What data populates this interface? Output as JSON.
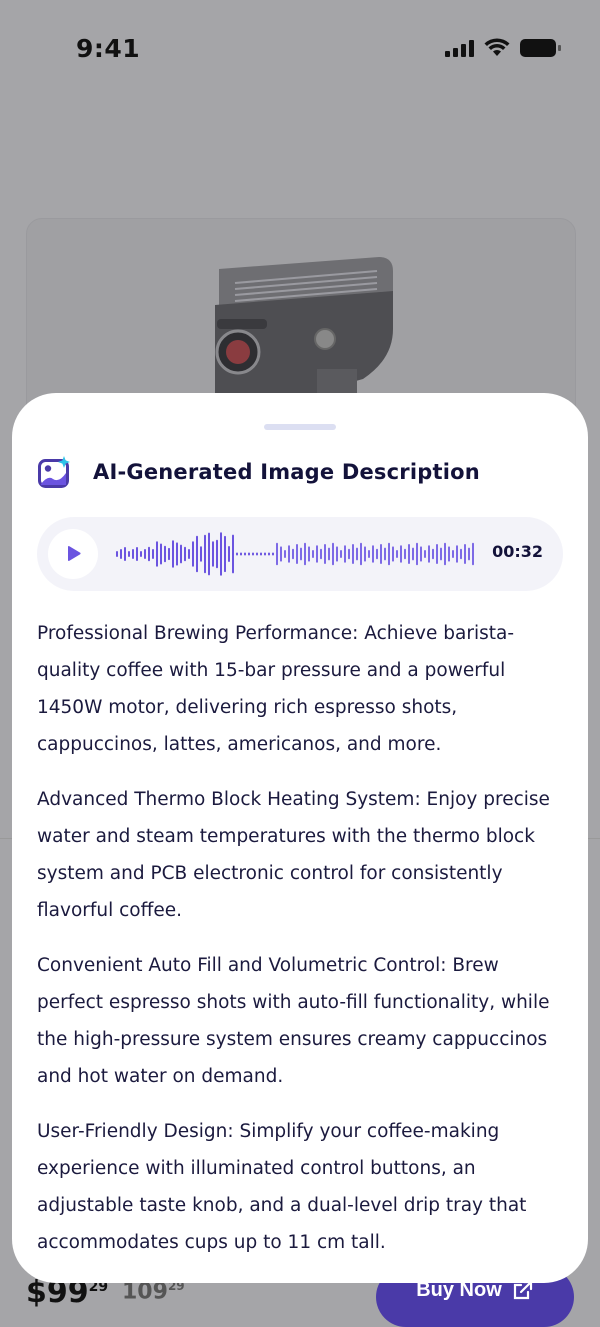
{
  "status": {
    "time": "9:41"
  },
  "bottom": {
    "price_main": "$99",
    "price_cents": "29",
    "price_old_main": "109",
    "price_old_cents": "29",
    "buy_label": "Buy Now"
  },
  "sheet": {
    "title": "AI-Generated Image Description",
    "audio": {
      "duration": "00:32"
    },
    "paragraphs": [
      "Professional Brewing Performance: Achieve barista-quality coffee with 15-bar pressure and a powerful 1450W motor, delivering rich espresso shots, cappuccinos, lattes, americanos, and more.",
      "Advanced Thermo Block Heating System: Enjoy precise water and steam temperatures with the thermo block system and PCB electronic control for consistently flavorful coffee.",
      "Convenient Auto Fill and Volumetric Control: Brew perfect espresso shots with auto-fill functionality, while the high-pressure system ensures creamy cappuccinos and hot water on demand.",
      "User-Friendly Design: Simplify your coffee-making experience with illuminated control buttons, an adjustable taste knob, and a dual-level drip tray that accommodates cups up to 11 cm tall."
    ]
  },
  "colors": {
    "accent": "#6b54e0",
    "ink": "#13123a",
    "sheet_bg": "#ffffff",
    "overlay": "#a5a5a8"
  }
}
